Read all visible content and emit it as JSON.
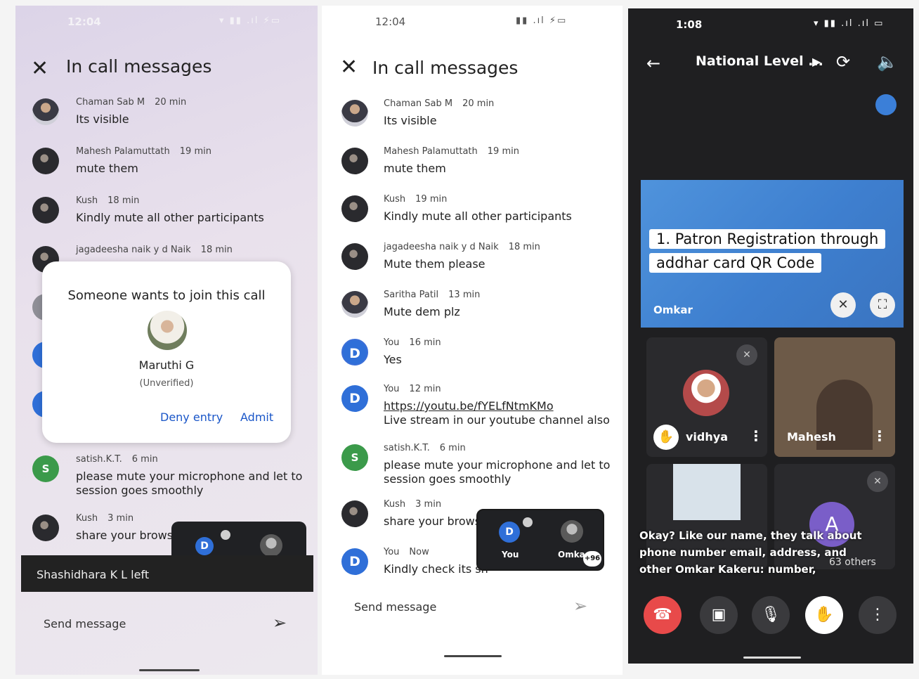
{
  "panel1": {
    "status_time": "12:04",
    "title": "In call messages",
    "messages": [
      {
        "sender": "Chaman Sab M",
        "time": "20 min",
        "text": "Its visible"
      },
      {
        "sender": "Mahesh Palamuttath",
        "time": "19 min",
        "text": "mute them"
      },
      {
        "sender": "Kush",
        "time": "18 min",
        "text": "Kindly mute all other participants"
      },
      {
        "sender": "jagadeesha naik y d Naik",
        "time": "18 min",
        "text": ""
      },
      {
        "sender": "satish.K.T.",
        "time": "6 min",
        "text": "please mute your  microphone  and let to",
        "text2": "session goes smoothly",
        "avatar_letter": "S"
      },
      {
        "sender": "Kush",
        "time": "3 min",
        "text": "share your brows"
      }
    ],
    "dialog": {
      "question": "Someone wants to join this call",
      "name": "Maruthi G",
      "status": "(Unverified)",
      "deny_label": "Deny entry",
      "admit_label": "Admit"
    },
    "pip": {
      "you_letter": "D"
    },
    "toast": "Shashidhara K L left",
    "send_placeholder": "Send message"
  },
  "panel2": {
    "status_time": "12:04",
    "title": "In call messages",
    "messages": [
      {
        "sender": "Chaman Sab M",
        "time": "20 min",
        "text": "Its visible"
      },
      {
        "sender": "Mahesh Palamuttath",
        "time": "19 min",
        "text": "mute them"
      },
      {
        "sender": "Kush",
        "time": "19 min",
        "text": "Kindly mute all other participants"
      },
      {
        "sender": "jagadeesha naik y d Naik",
        "time": "18 min",
        "text": "Mute them please"
      },
      {
        "sender": "Saritha Patil",
        "time": "13 min",
        "text": "Mute dem plz"
      },
      {
        "sender": "You",
        "time": "16 min",
        "text": "Yes",
        "avatar_letter": "D"
      },
      {
        "sender": "You",
        "time": "12 min",
        "link": "https://youtu.be/fYELfNtmKMo",
        "text": "Live stream in our youtube channel also",
        "avatar_letter": "D"
      },
      {
        "sender": "satish.K.T.",
        "time": "6 min",
        "text": "please mute your  microphone  and let to",
        "text2": "session goes smoothly",
        "avatar_letter": "S"
      },
      {
        "sender": "Kush",
        "time": "3 min",
        "text": "share your brows"
      },
      {
        "sender": "You",
        "time": "Now",
        "text": "Kindly check its sh",
        "avatar_letter": "D"
      }
    ],
    "pip": {
      "you_letter": "D",
      "you_label": "You",
      "other_label": "Omka",
      "badge": "+96"
    },
    "send_placeholder": "Send message"
  },
  "panel3": {
    "status_time": "1:08",
    "meeting_title": "National Level ...",
    "presentation": {
      "line1": "1. Patron Registration through",
      "line2": "addhar card QR Code",
      "owner": "Omkar"
    },
    "tiles": [
      {
        "name": "vidhya"
      },
      {
        "name": "Mahesh"
      }
    ],
    "caption": "Okay? Like our name, they talk about phone number email, address, and other Omkar Kakeru: number,",
    "others": "63 others",
    "tile_letter": "A"
  }
}
